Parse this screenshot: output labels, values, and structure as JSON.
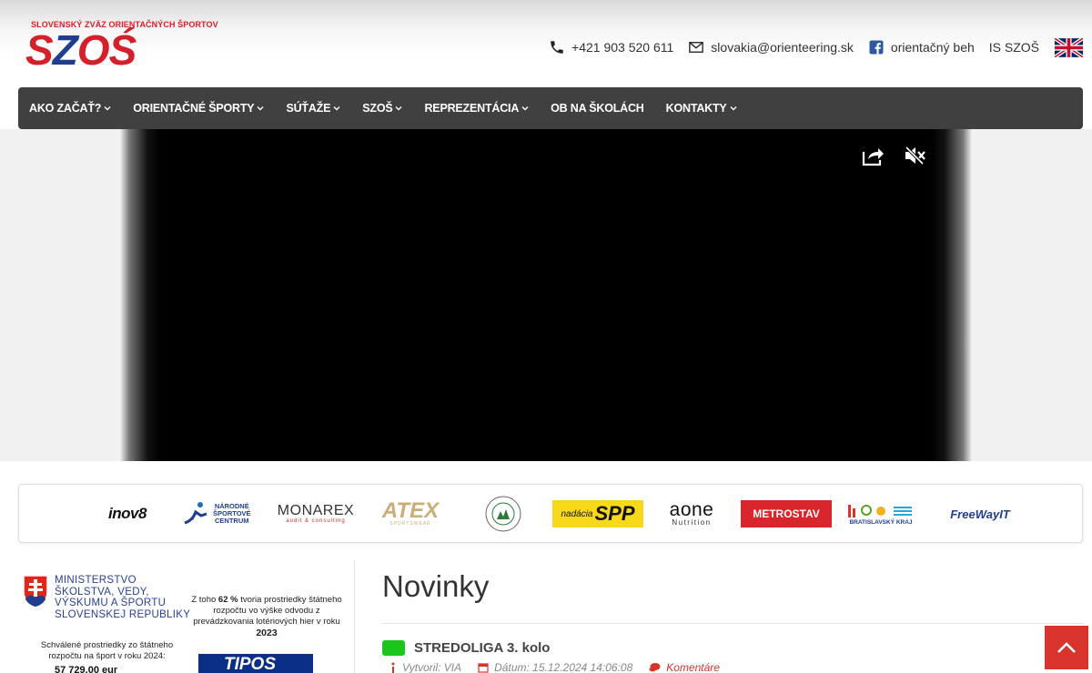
{
  "logo": {
    "top_text": "SLOVENSKÝ ZVÄZ ORIENTAČNÝCH ŠPORTOV",
    "main_s": "S",
    "main_z": "Z",
    "main_os": "OŚ"
  },
  "contacts": {
    "phone": "+421 903 520 611",
    "email": "slovakia@orienteering.sk",
    "facebook": "orientačný beh",
    "is_link": "IS SZOŠ"
  },
  "nav": {
    "items": [
      {
        "label": "AKO ZAČAŤ?",
        "dropdown": true
      },
      {
        "label": "ORIENTAČNÉ ŠPORTY",
        "dropdown": true
      },
      {
        "label": "SÚŤAŽE",
        "dropdown": true
      },
      {
        "label": "SZOŠ",
        "dropdown": true
      },
      {
        "label": "REPREZENTÁCIA",
        "dropdown": true
      },
      {
        "label": "OB NA ŠKOLÁCH",
        "dropdown": false
      },
      {
        "label": "KONTAKTY",
        "dropdown": true
      }
    ]
  },
  "video": {
    "share_icon": "share-icon",
    "mute_icon": "muted-speaker-icon"
  },
  "sponsors": {
    "inov": "inov8",
    "nsc_line1": "NÁRODNÉ",
    "nsc_line2": "ŠPORTOVÉ",
    "nsc_line3": "CENTRUM",
    "monarex": "MONAREX",
    "monarex_sub": "audit & consulting",
    "atex": "ATEX",
    "atex_sub": "SPORTSWEAR",
    "spp_a": "nadácia",
    "spp_b": "SPP",
    "aone": "aone",
    "aone_sub": "Nutrition",
    "metrostav": "METROSTAV",
    "bsk": "BRATISLAVSKÝ KRAJ",
    "freeway": "FreeWayIT"
  },
  "sidebar": {
    "ministry_l1": "MINISTERSTVO",
    "ministry_l2": "ŠKOLSTVA, VEDY,",
    "ministry_l3": "VÝSKUMU A ŠPORTU",
    "ministry_l4": "SLOVENSKEJ REPUBLIKY",
    "approved_text": "Schválené prostriedky zo štátneho rozpočtu na šport v roku 2024:",
    "amount": "57 729,00 eur",
    "lottery_pre": "Z toho",
    "lottery_pct": "62 %",
    "lottery_mid": "tvoria prostriedky štátneho rozpočtu vo výške odvodu z prevádzkovania lotériových hier v roku",
    "lottery_year": "2023",
    "tipos": "TIPOS"
  },
  "news": {
    "title": "Novinky",
    "item_title": "STREDOLIGA 3. kolo",
    "author": "Vytvoril: VIA",
    "date": "Dátum: 15.12.2024 14:06:08",
    "comments": "Komentáre"
  },
  "colors": {
    "brand_red": "#d4202a",
    "brand_blue": "#1f3e8f",
    "nav_bg": "#404040",
    "accent_red": "#d9342b",
    "tag_green": "#1ac61a"
  }
}
